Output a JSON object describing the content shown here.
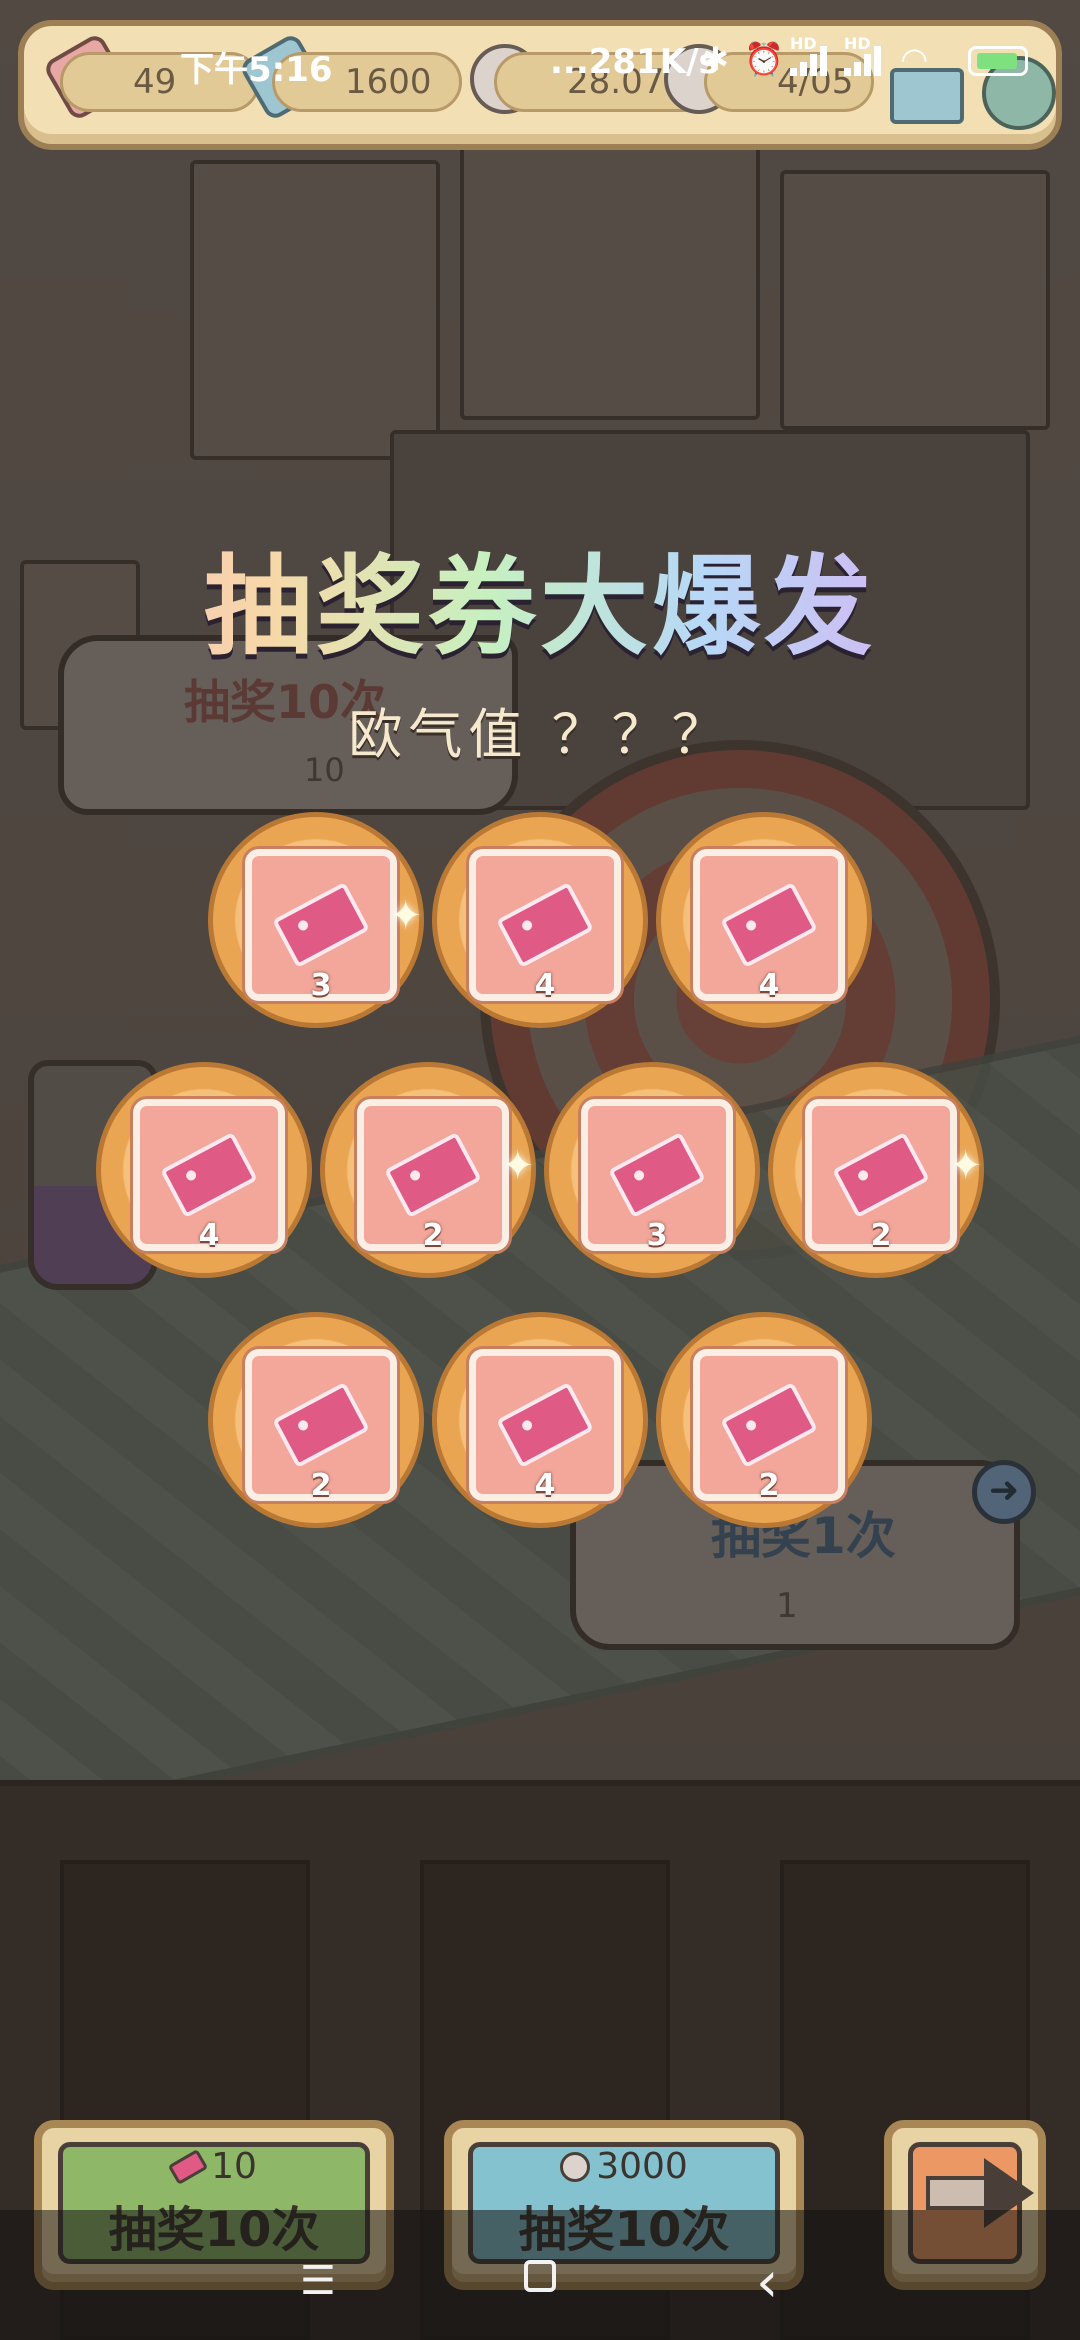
{
  "status_bar": {
    "time": "下午5:16",
    "network_speed": "...281K/s",
    "icons": [
      "bluetooth-icon",
      "alarm-icon",
      "signal-hd-icon",
      "signal-hd-icon",
      "wifi-icon",
      "battery-charging-icon"
    ],
    "hd_label": "HD"
  },
  "resource_bar": {
    "ticket_partial": "49",
    "coins": "1600",
    "ghost_partial": "28.07",
    "progress_partial": "4/05"
  },
  "overlay": {
    "title": "抽奖券大爆发",
    "luck_label": "欧气值 ？？？"
  },
  "rewards": [
    {
      "qty": "3",
      "sparkle": true
    },
    {
      "qty": "4",
      "sparkle": false
    },
    {
      "qty": "4",
      "sparkle": false
    },
    {
      "qty": "4",
      "sparkle": false
    },
    {
      "qty": "2",
      "sparkle": true
    },
    {
      "qty": "3",
      "sparkle": false
    },
    {
      "qty": "2",
      "sparkle": true
    },
    {
      "qty": "2",
      "sparkle": false
    },
    {
      "qty": "4",
      "sparkle": false
    },
    {
      "qty": "2",
      "sparkle": false
    }
  ],
  "background_signs": {
    "left_title": "抽奖10次",
    "left_cost": "10",
    "right_title": "抽奖1次",
    "right_cost": "1"
  },
  "bottom_buttons": {
    "ticket_draw": {
      "cost": "10",
      "label": "抽奖10次"
    },
    "ghost_draw": {
      "cost": "3000",
      "label": "抽奖10次"
    }
  },
  "nav": {
    "menu_glyph": "☰",
    "back_glyph": "‹"
  },
  "colors": {
    "reward_bg": "#e9a552",
    "card_bg": "#f2a79a",
    "ticket": "#e05a86",
    "green_button": "#8fb768",
    "blue_button": "#84c2cf",
    "orange_button": "#eb9865"
  }
}
